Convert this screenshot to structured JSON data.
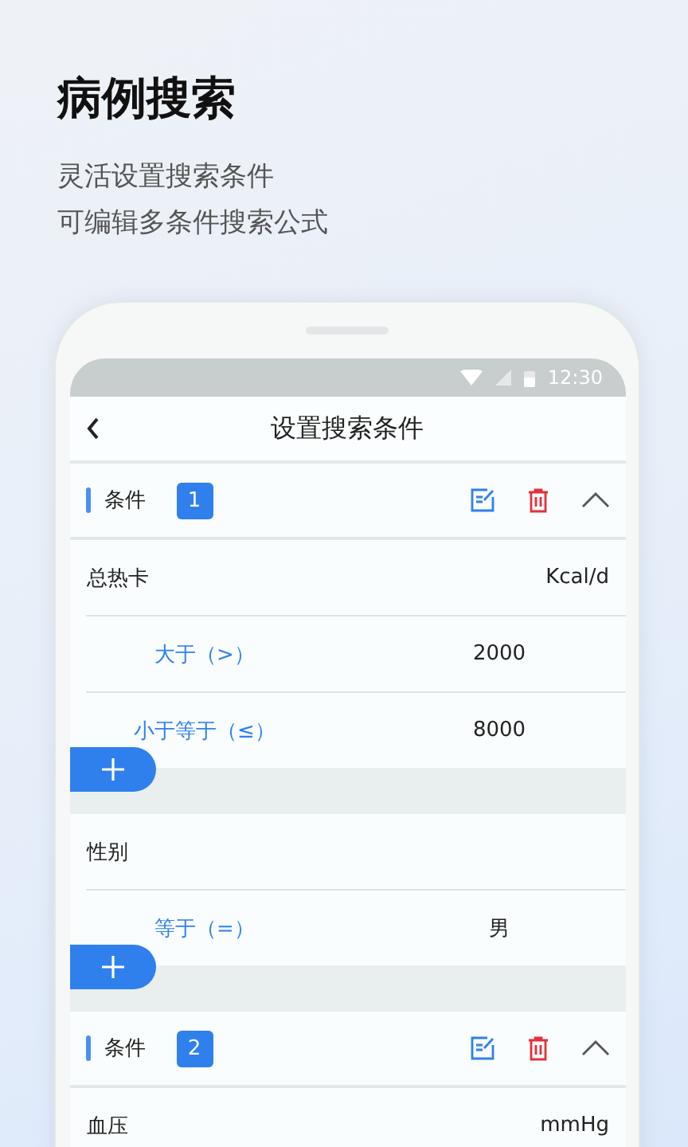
{
  "heading": "病例搜索",
  "subtitle_lines": [
    "灵活设置搜索条件",
    "可编辑多条件搜索公式"
  ],
  "status_bar": {
    "time": "12:30"
  },
  "screen": {
    "title": "设置搜索条件"
  },
  "conditions": [
    {
      "label": "条件",
      "number": "1",
      "expanded": true,
      "fields": [
        {
          "name": "总热卡",
          "unit": "Kcal/d",
          "rules": [
            {
              "operator": "大于（>）",
              "value": "2000"
            },
            {
              "operator": "小于等于（≤）",
              "value": "8000"
            }
          ]
        },
        {
          "name": "性别",
          "rules": [
            {
              "operator": "等于（=）",
              "value": "男"
            }
          ]
        }
      ]
    },
    {
      "label": "条件",
      "number": "2",
      "expanded": true,
      "fields": [
        {
          "name": "血压",
          "unit": "mmHg"
        }
      ]
    }
  ]
}
